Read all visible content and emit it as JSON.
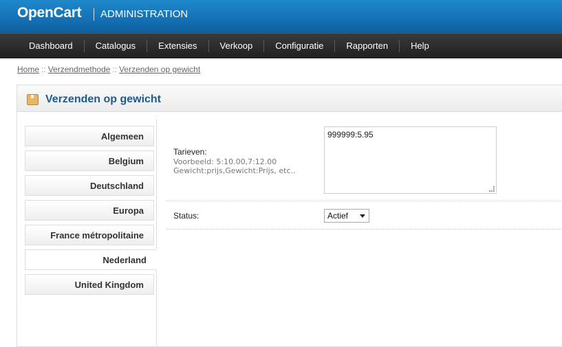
{
  "header": {
    "logo": "OpenCart",
    "subtitle": "ADMINISTRATION"
  },
  "menu": {
    "items": [
      "Dashboard",
      "Catalogus",
      "Extensies",
      "Verkoop",
      "Configuratie",
      "Rapporten",
      "Help"
    ]
  },
  "breadcrumb": {
    "items": [
      "Home",
      "Verzendmethode",
      "Verzenden op gewicht"
    ],
    "separator": "::"
  },
  "box": {
    "title": "Verzenden op gewicht",
    "icon": "shipping-box-icon"
  },
  "tabs": {
    "items": [
      "Algemeen",
      "Belgium",
      "Deutschland",
      "Europa",
      "France métropolitaine",
      "Nederland",
      "United Kingdom"
    ],
    "active": "Nederland"
  },
  "form": {
    "rates_label": "Tarieven:",
    "rates_help_1": "Voorbeeld: 5:10.00,7:12.00",
    "rates_help_2": "Gewicht:prijs,Gewicht:Prijs, etc..",
    "rates_value": "999999:5.95",
    "status_label": "Status:",
    "status_value": "Actief"
  },
  "colors": {
    "header_blue": "#1470b3",
    "menu_dark": "#2a2a2a",
    "title_blue": "#1d5a8e"
  }
}
